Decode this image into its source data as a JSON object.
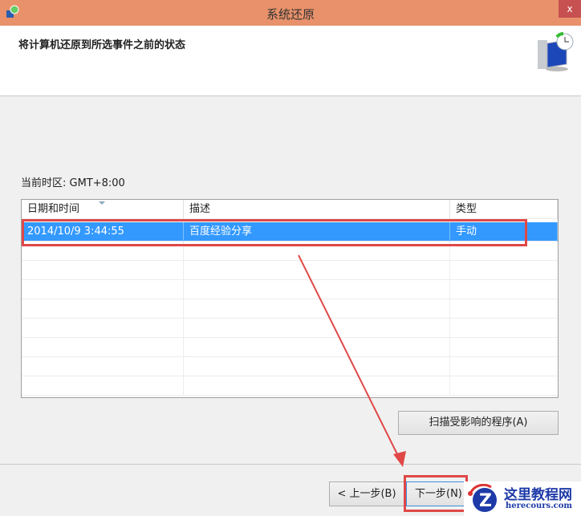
{
  "window": {
    "title": "系统还原",
    "close": "x"
  },
  "header": {
    "heading": "将计算机还原到所选事件之前的状态"
  },
  "timezone": "当前时区: GMT+8:00",
  "table": {
    "columns": [
      "日期和时间",
      "描述",
      "类型"
    ],
    "rows": [
      {
        "datetime": "2014/10/9 3:44:55",
        "description": "百度经验分享",
        "type": "手动",
        "selected": true
      }
    ]
  },
  "buttons": {
    "scan": "扫描受影响的程序(A)",
    "back": "< 上一步(B)",
    "next": "下一步(N)"
  },
  "watermark": {
    "title": "这里教程网",
    "url": "herecours.com"
  },
  "colors": {
    "titlebar": "#e8916a",
    "selection": "#3399ff",
    "annotation": "#e04848"
  }
}
